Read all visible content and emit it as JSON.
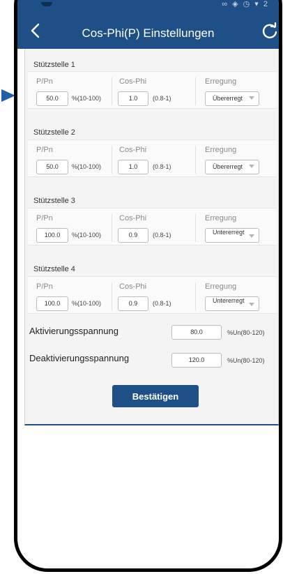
{
  "header": {
    "title": "Cos-Phi(P) Einstellungen",
    "back_icon": "chevron-left-icon",
    "refresh_icon": "refresh-icon",
    "bg_color": "#1e4f86"
  },
  "columns": {
    "ppn_label": "P/Pn",
    "cosphi_label": "Cos-Phi",
    "erregung_label": "Erregung",
    "ppn_range": "%(10-100)",
    "cosphi_range": "(0.8-1)"
  },
  "sections": [
    {
      "title": "Stützstelle 1",
      "ppn": "50.0",
      "cosphi": "1.0",
      "erregung": "Übererregt"
    },
    {
      "title": "Stützstelle 2",
      "ppn": "50.0",
      "cosphi": "1.0",
      "erregung": "Übererregt"
    },
    {
      "title": "Stützstelle 3",
      "ppn": "100.0",
      "cosphi": "0.9",
      "erregung": "Untererregt"
    },
    {
      "title": "Stützstelle 4",
      "ppn": "100.0",
      "cosphi": "0.9",
      "erregung": "Untererregt"
    }
  ],
  "activation": {
    "label": "Aktivierungsspannung",
    "value": "80.0",
    "range": "%Un(80-120)"
  },
  "deactivation": {
    "label": "Deaktivierungsspannung",
    "value": "120.0",
    "range": "%Un(80-120)"
  },
  "confirm_label": "Bestätigen"
}
